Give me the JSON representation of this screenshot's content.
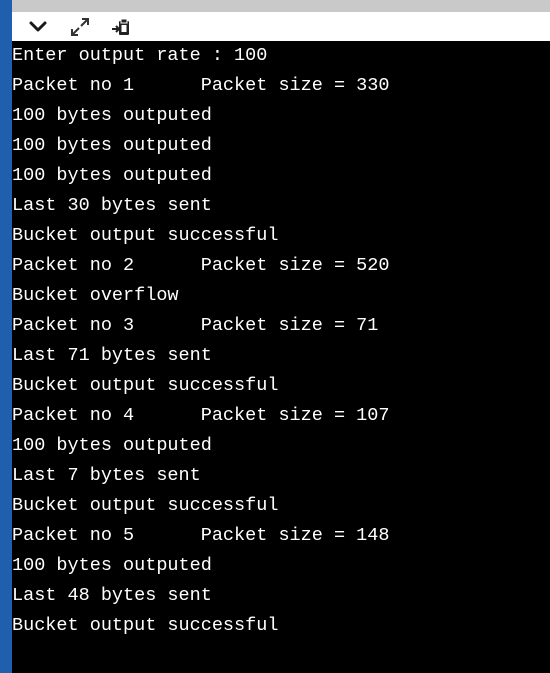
{
  "toolbar": {
    "icons": [
      "chevron-down-icon",
      "expand-icon",
      "clipboard-paste-icon"
    ]
  },
  "terminal": {
    "lines": [
      "Enter output rate : 100",
      "Packet no 1      Packet size = 330",
      "100 bytes outputed",
      "100 bytes outputed",
      "100 bytes outputed",
      "Last 30 bytes sent",
      "Bucket output successful",
      "Packet no 2      Packet size = 520",
      "Bucket overflow",
      "Packet no 3      Packet size = 71",
      "Last 71 bytes sent",
      "Bucket output successful",
      "Packet no 4      Packet size = 107",
      "100 bytes outputed",
      "Last 7 bytes sent",
      "Bucket output successful",
      "Packet no 5      Packet size = 148",
      "100 bytes outputed",
      "Last 48 bytes sent",
      "Bucket output successful"
    ]
  },
  "colors": {
    "background": "#000000",
    "text": "#ffffff",
    "left_bar": "#1f5fad",
    "toolbar": "#ffffff"
  }
}
